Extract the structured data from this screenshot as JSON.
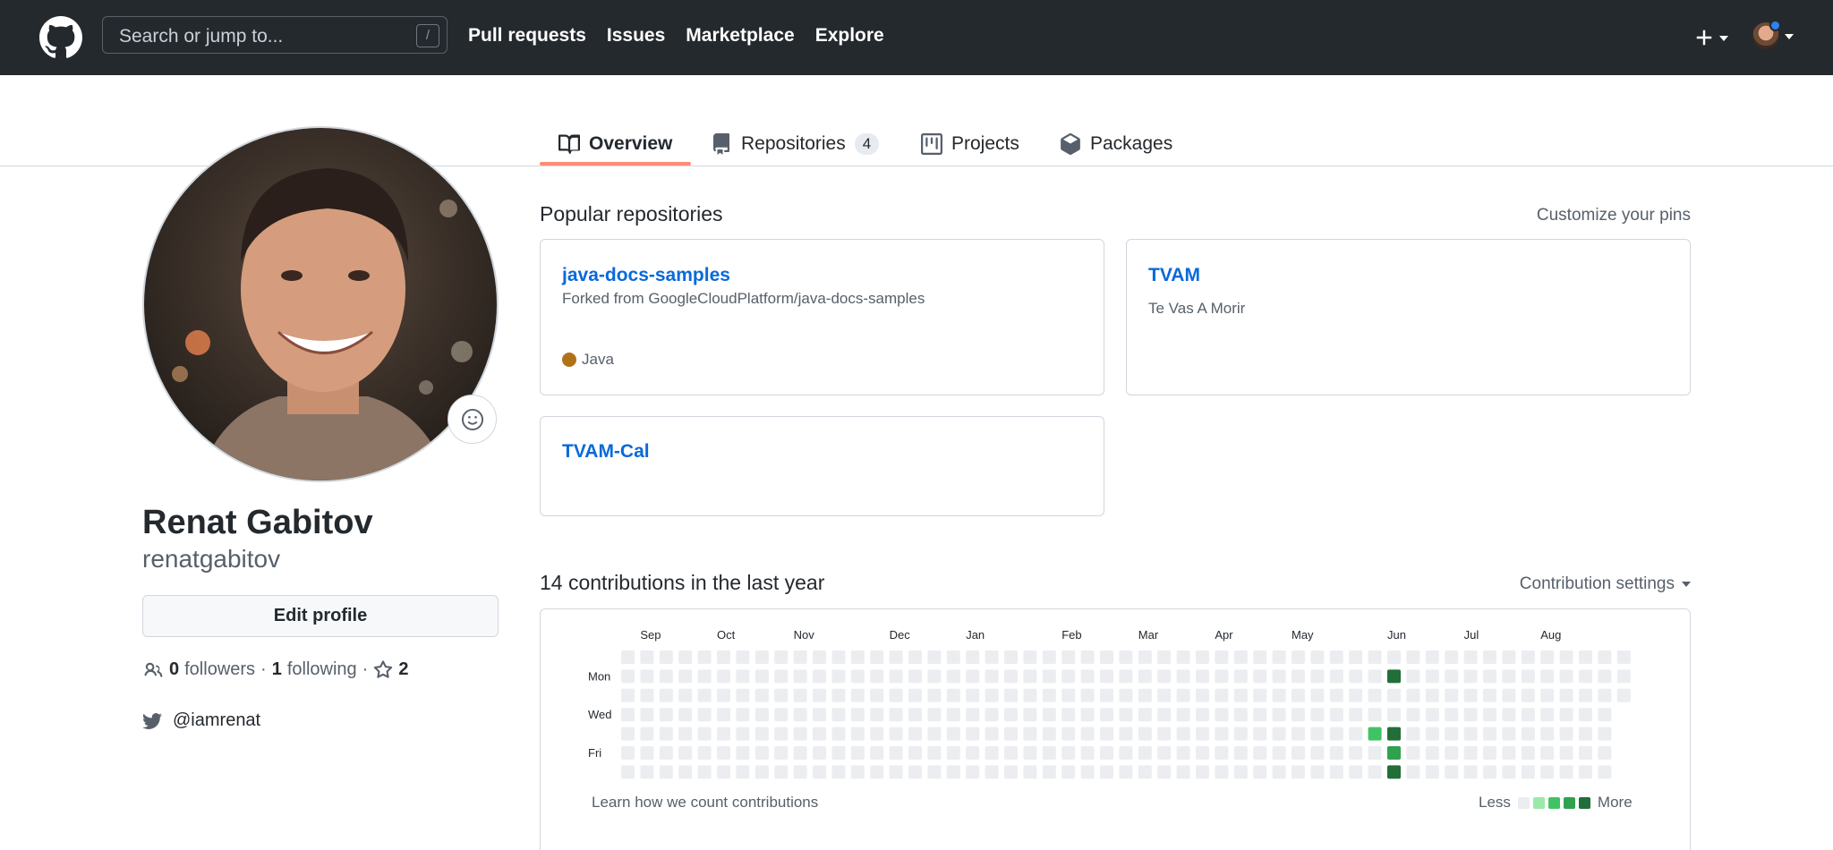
{
  "header": {
    "search_placeholder": "Search or jump to...",
    "search_key": "/",
    "nav": [
      "Pull requests",
      "Issues",
      "Marketplace",
      "Explore"
    ],
    "icons": [
      "github-logo-icon",
      "plus-icon",
      "avatar-menu"
    ]
  },
  "tabs": [
    {
      "label": "Overview",
      "icon": "book-icon",
      "selected": true
    },
    {
      "label": "Repositories",
      "icon": "repo-icon",
      "count": "4"
    },
    {
      "label": "Projects",
      "icon": "project-icon"
    },
    {
      "label": "Packages",
      "icon": "package-icon"
    }
  ],
  "profile": {
    "name": "Renat Gabitov",
    "username": "renatgabitov",
    "edit_label": "Edit profile",
    "followers_count": "0",
    "followers_label": "followers",
    "sep": "·",
    "following_count": "1",
    "following_label": "following",
    "stars_count": "2",
    "twitter": "@iamrenat"
  },
  "popular": {
    "title": "Popular repositories",
    "customize": "Customize your pins",
    "repos": [
      {
        "name": "java-docs-samples",
        "fork_note": "Forked from GoogleCloudPlatform/java-docs-samples",
        "language": "Java",
        "language_color": "#b07219"
      },
      {
        "name": "TVAM",
        "description": "Te Vas A Morir"
      },
      {
        "name": "TVAM-Cal"
      }
    ]
  },
  "contributions": {
    "title": "14 contributions in the last year",
    "settings": "Contribution settings",
    "months": [
      "Sep",
      "Oct",
      "Nov",
      "Dec",
      "Jan",
      "Feb",
      "Mar",
      "Apr",
      "May",
      "Jun",
      "Jul",
      "Aug"
    ],
    "day_labels": [
      "Mon",
      "Wed",
      "Fri"
    ],
    "learn": "Learn how we count contributions",
    "less": "Less",
    "more": "More",
    "level_colors": [
      "#ebedf0",
      "#9be9a8",
      "#40c463",
      "#30a14e",
      "#216e39"
    ],
    "active_days": [
      {
        "week": 39,
        "day": 4,
        "level": 2
      },
      {
        "week": 40,
        "day": 1,
        "level": 4
      },
      {
        "week": 40,
        "day": 4,
        "level": 4
      },
      {
        "week": 40,
        "day": 5,
        "level": 3
      },
      {
        "week": 40,
        "day": 6,
        "level": 4
      }
    ]
  }
}
